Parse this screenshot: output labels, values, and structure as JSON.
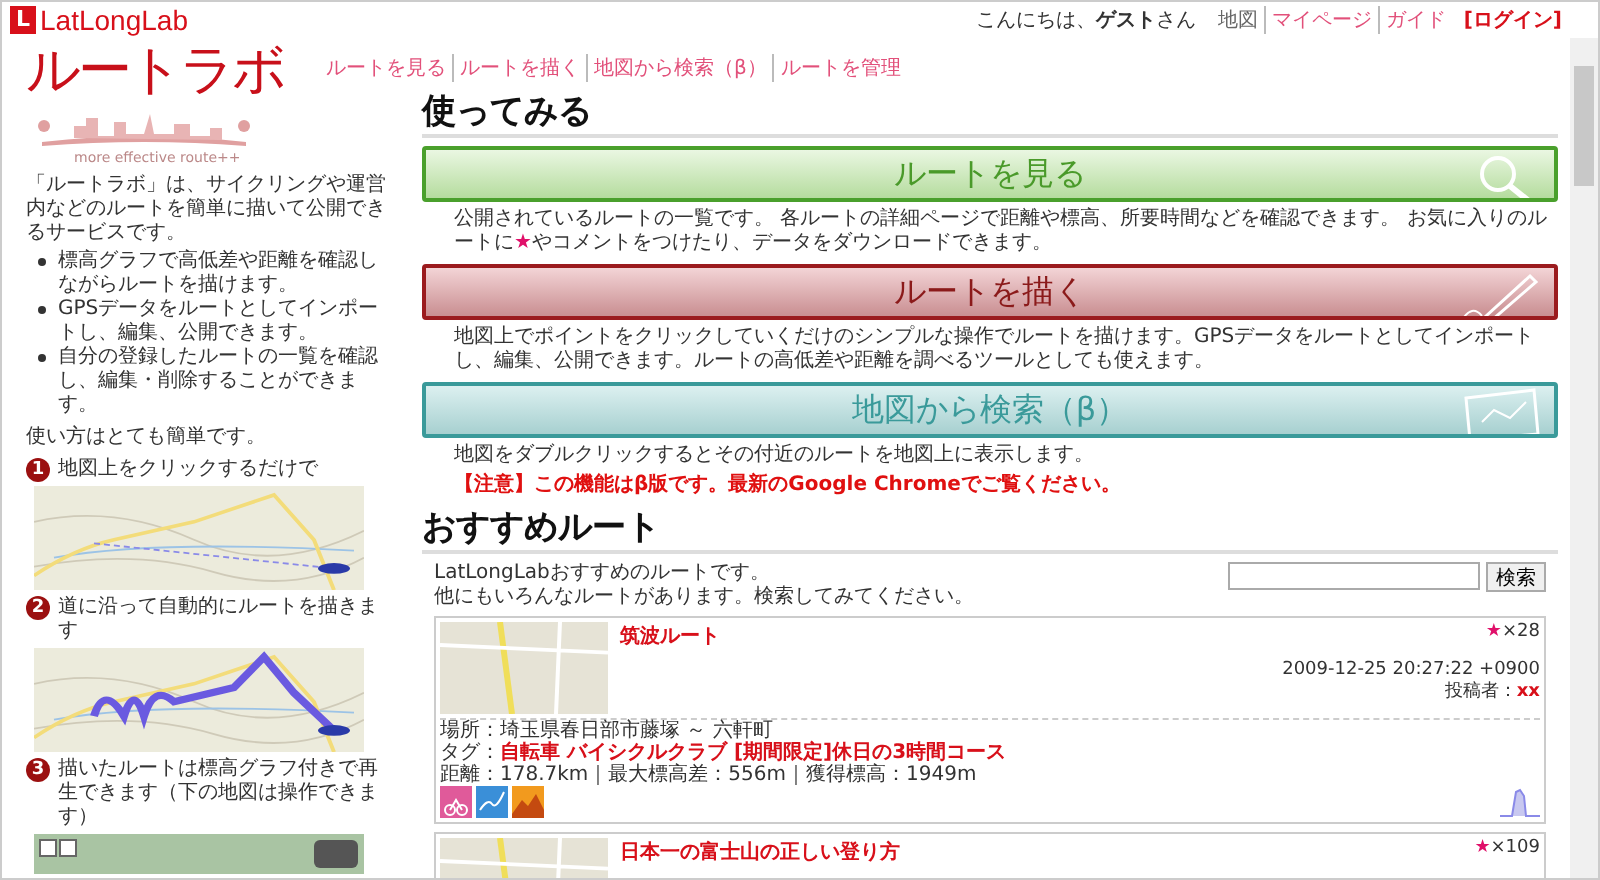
{
  "header": {
    "logo_mark": "L",
    "brand": "LatLongLab",
    "greeting": "こんにちは、**ゲスト**さん",
    "links": [
      {
        "label": "地図",
        "kind": "plain"
      },
      {
        "label": "マイページ",
        "kind": "link"
      },
      {
        "label": "ガイド",
        "kind": "link"
      },
      {
        "label": "[ログイン]",
        "kind": "login"
      }
    ]
  },
  "logo": {
    "title": "ルートラボ",
    "tagline": "more effective route++"
  },
  "subnav": [
    "ルートを見る",
    "ルートを描く",
    "地図から検索（β）",
    "ルートを管理"
  ],
  "sidebar": {
    "intro": "「ルートラボ」は、サイクリングや運営内などのルートを簡単に描いて公開できるサービスです。",
    "bullets": [
      "標高グラフで高低差や距離を確認しながらルートを描けます。",
      "GPSデータをルートとしてインポートし、編集、公開できます。",
      "自分の登録したルートの一覧を確認し、編集・削除することができます。"
    ],
    "note": "使い方はとても簡単です。",
    "steps": [
      {
        "number": "1",
        "text": "地図上をクリックするだけで",
        "kind": "dashed"
      },
      {
        "number": "2",
        "text": "道に沿って自動的にルートを描きます",
        "kind": "route"
      },
      {
        "number": "3",
        "text": "描いたルートは標高グラフ付きで再生できます（下の地図は操作できます）",
        "kind": "live"
      }
    ]
  },
  "main": {
    "title": "使ってみる",
    "actions": [
      {
        "kind": "view",
        "label": "ルートを見る",
        "description": "公開されているルートの一覧です。 各ルートの詳細ページで距離や標高、所要時間などを確認できます。 お気に入りのルートに",
        "star": "★",
        "description_after": "やコメントをつけたり、データをダウンロードできます。"
      },
      {
        "kind": "draw",
        "label": "ルートを描く",
        "description": "地図上でポイントをクリックしていくだけのシンプルな操作でルートを描けます。GPSデータをルートとしてインポートし、編集、公開できます。ルートの高低差や距離を調べるツールとしても使えます。"
      },
      {
        "kind": "search",
        "label": "地図から検索（β）",
        "description": "地図をダブルクリックするとその付近のルートを地図上に表示します。",
        "notice": "【注意】この機能はβ版です。最新のGoogle Chromeでご覧ください。"
      }
    ]
  },
  "recommended": {
    "title": "おすすめルート",
    "intro": [
      "LatLongLabおすすめのルートです。",
      "他にもいろんなルートがあります。検索してみてください。"
    ],
    "search_button": "検索",
    "routes": [
      {
        "title": "筑波ルート",
        "star": "★",
        "count": "×28",
        "date": "2009-12-25 20:27:22 +0900",
        "poster_label": "投稿者：",
        "poster": "xx",
        "place": "場所：埼玉県春日部市藤塚 ～ 六軒町",
        "tag_label": "タグ：",
        "tags": "自転車 バイシクルクラブ [期間限定]休日の3時間コース",
        "stats": "距離：178.7km｜最大標高差：556m｜獲得標高：1949m"
      },
      {
        "title": "日本一の富士山の正しい登り方",
        "star": "★",
        "count": "×109"
      }
    ]
  }
}
